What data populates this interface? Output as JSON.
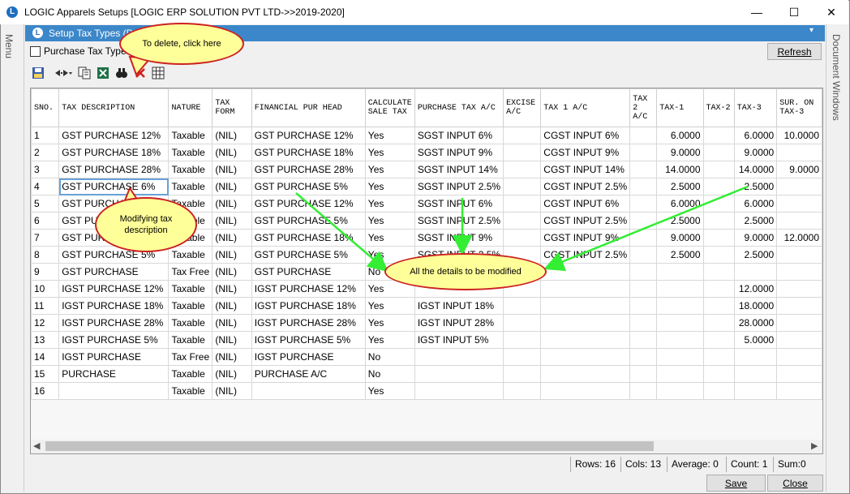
{
  "window": {
    "title": "LOGIC Apparels Setups  [LOGIC ERP SOLUTION PVT LTD->>2019-2020]",
    "logo": "L",
    "minimize": "—",
    "maximize": "☐",
    "close": "✕"
  },
  "side": {
    "left": "Menu",
    "right": "Document Windows"
  },
  "pane": {
    "title": "Setup Tax Types (P",
    "logo": "L",
    "dropdown": "▾"
  },
  "filter": {
    "checkbox_label": "Purchase Tax Types",
    "checked": false
  },
  "refresh_label": "Refresh",
  "toolbar": {
    "icons": [
      "save-icon",
      "column-width-icon",
      "copy-icon",
      "excel-icon",
      "find-icon",
      "delete-icon",
      "grid-icon"
    ]
  },
  "columns": [
    "SNO.",
    "TAX DESCRIPTION",
    "NATURE",
    "TAX FORM",
    "FINANCIAL PUR HEAD",
    "CALCULATE SALE TAX",
    "PURCHASE TAX A/C",
    "EXCISE A/C",
    "TAX 1 A/C",
    "TAX 2 A/C",
    "TAX-1",
    "TAX-2",
    "TAX-3",
    "SUR. ON TAX-3"
  ],
  "rows": [
    [
      "1",
      "GST PURCHASE 12%",
      "Taxable",
      "(NIL)",
      "GST PURCHASE 12%",
      "Yes",
      "SGST  INPUT 6%",
      "",
      "CGST INPUT 6%",
      "",
      "6.0000",
      "",
      "6.0000",
      "10.0000"
    ],
    [
      "2",
      "GST PURCHASE 18%",
      "Taxable",
      "(NIL)",
      "GST PURCHASE 18%",
      "Yes",
      "SGST INPUT 9%",
      "",
      "CGST INPUT 9%",
      "",
      "9.0000",
      "",
      "9.0000",
      ""
    ],
    [
      "3",
      "GST PURCHASE 28%",
      "Taxable",
      "(NIL)",
      "GST PURCHASE 28%",
      "Yes",
      "SGST INPUT 14%",
      "",
      "CGST INPUT 14%",
      "",
      "14.0000",
      "",
      "14.0000",
      "9.0000"
    ],
    [
      "4",
      "GST PURCHASE 6%",
      "Taxable",
      "(NIL)",
      "GST PURCHASE 5%",
      "Yes",
      "SGST INPUT 2.5%",
      "",
      "CGST INPUT 2.5%",
      "",
      "2.5000",
      "",
      "2.5000",
      ""
    ],
    [
      "5",
      "GST PURCHASE 12%",
      "Taxable",
      "(NIL)",
      "GST PURCHASE 12%",
      "Yes",
      "SGST  INPUT 6%",
      "",
      "CGST INPUT 6%",
      "",
      "6.0000",
      "",
      "6.0000",
      ""
    ],
    [
      "6",
      "GST PURCHASE 5%",
      "Taxable",
      "(NIL)",
      "GST PURCHASE 5%",
      "Yes",
      "SGST INPUT 2.5%",
      "",
      "CGST INPUT 2.5%",
      "",
      "2.5000",
      "",
      "2.5000",
      ""
    ],
    [
      "7",
      "GST PURCHASE 18%",
      "Taxable",
      "(NIL)",
      "GST PURCHASE 18%",
      "Yes",
      "SGST INPUT 9%",
      "",
      "CGST INPUT 9%",
      "",
      "9.0000",
      "",
      "9.0000",
      "12.0000"
    ],
    [
      "8",
      "GST PURCHASE 5%",
      "Taxable",
      "(NIL)",
      "GST PURCHASE 5%",
      "Yes",
      "SGST INPUT 2.5%",
      "",
      "CGST INPUT 2.5%",
      "",
      "2.5000",
      "",
      "2.5000",
      ""
    ],
    [
      "9",
      "GST PURCHASE",
      "Tax Free",
      "(NIL)",
      "GST PURCHASE",
      "No",
      "",
      "",
      "",
      "",
      "",
      "",
      "",
      ""
    ],
    [
      "10",
      "IGST PURCHASE  12%",
      "Taxable",
      "(NIL)",
      "IGST PURCHASE 12%",
      "Yes",
      "",
      "",
      "",
      "",
      "",
      "",
      "12.0000",
      ""
    ],
    [
      "11",
      "IGST PURCHASE 18%",
      "Taxable",
      "(NIL)",
      "IGST PURCHASE 18%",
      "Yes",
      "IGST INPUT 18%",
      "",
      "",
      "",
      "",
      "",
      "18.0000",
      ""
    ],
    [
      "12",
      "IGST PURCHASE 28%",
      "Taxable",
      "(NIL)",
      "IGST PURCHASE 28%",
      "Yes",
      "IGST INPUT 28%",
      "",
      "",
      "",
      "",
      "",
      "28.0000",
      ""
    ],
    [
      "13",
      "IGST PURCHASE 5%",
      "Taxable",
      "(NIL)",
      "IGST PURCHASE 5%",
      "Yes",
      "IGST INPUT 5%",
      "",
      "",
      "",
      "",
      "",
      "5.0000",
      ""
    ],
    [
      "14",
      "IGST PURCHASE",
      "Tax Free",
      "(NIL)",
      "IGST PURCHASE",
      "No",
      "",
      "",
      "",
      "",
      "",
      "",
      "",
      ""
    ],
    [
      "15",
      "PURCHASE",
      "Taxable",
      "(NIL)",
      "PURCHASE A/C",
      "No",
      "",
      "",
      "",
      "",
      "",
      "",
      "",
      ""
    ],
    [
      "16",
      "",
      "Taxable",
      "(NIL)",
      "",
      "Yes",
      "",
      "",
      "",
      "",
      "",
      "",
      "",
      ""
    ]
  ],
  "status": {
    "rows": "Rows: 16",
    "cols": "Cols: 13",
    "average": "Average: 0",
    "count": "Count: 1",
    "sum": "Sum:0"
  },
  "buttons": {
    "save": "Save",
    "close": "Close"
  },
  "callouts": {
    "delete": "To delete, click here",
    "modify_desc": "Modifying tax description",
    "modify_all": "All the details to be modified"
  },
  "colors": {
    "header_blue": "#3b87c9",
    "callout_fill": "#ffff99",
    "callout_border": "#cc2222",
    "arrow": "#33ee33"
  }
}
